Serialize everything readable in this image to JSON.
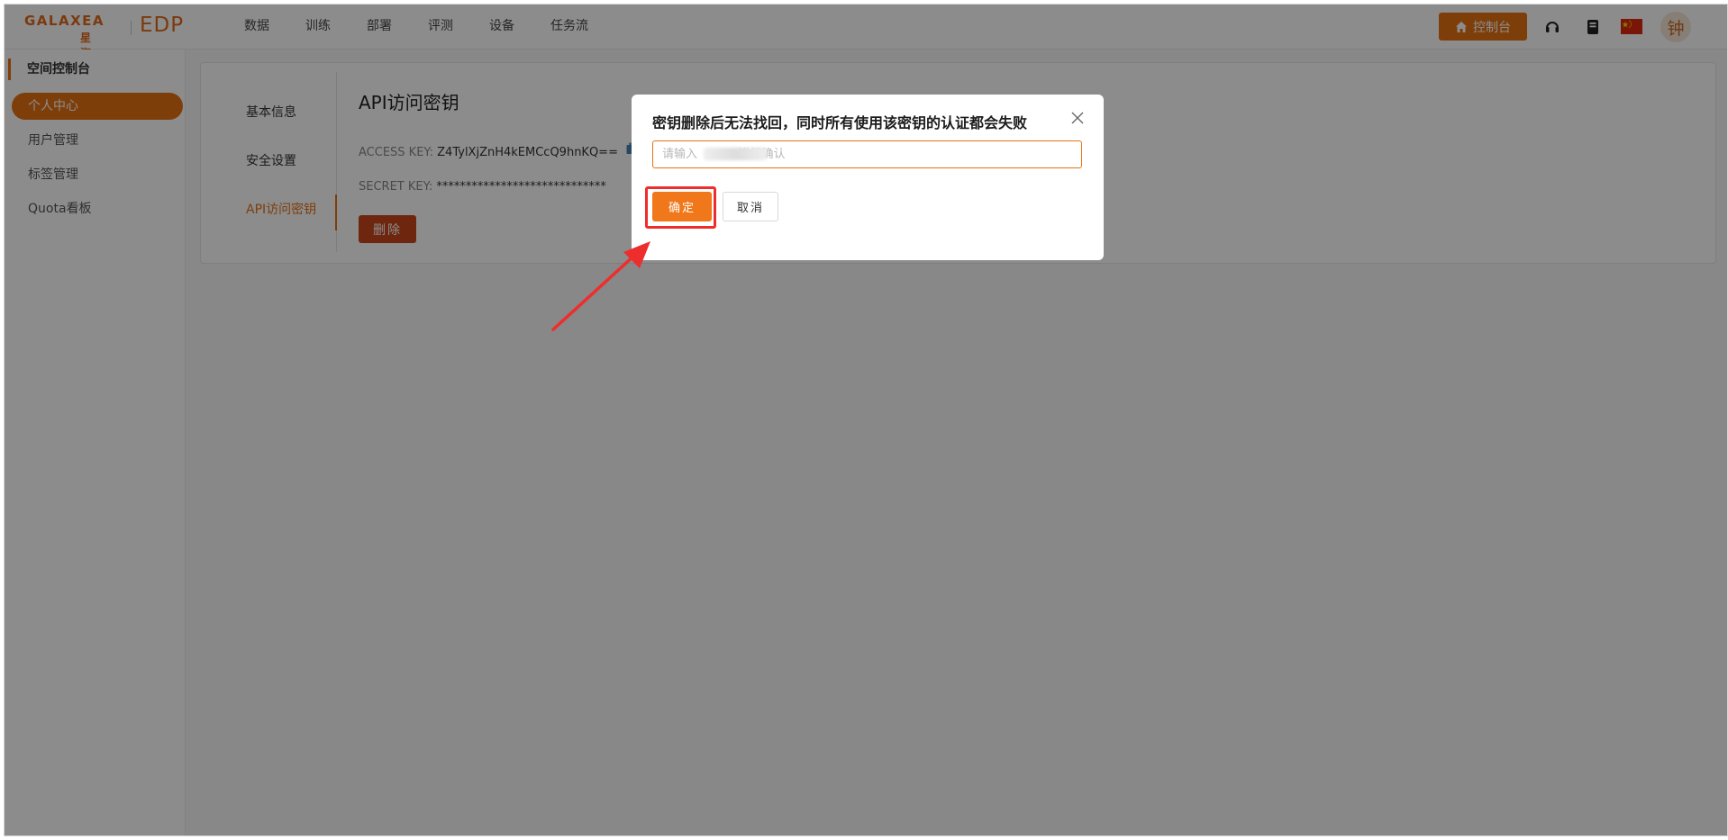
{
  "brand": {
    "logo_text": "GALAXEA",
    "logo_cn": "星海图",
    "product": "EDP"
  },
  "header": {
    "nav": [
      "数据",
      "训练",
      "部署",
      "评测",
      "设备",
      "任务流"
    ],
    "console_label": "控制台",
    "avatar_text": "钟"
  },
  "sidebar": {
    "title": "空间控制台",
    "items": [
      {
        "label": "个人中心",
        "active": true
      },
      {
        "label": "用户管理",
        "active": false
      },
      {
        "label": "标签管理",
        "active": false
      },
      {
        "label": "Quota看板",
        "active": false
      }
    ]
  },
  "subnav": [
    "基本信息",
    "安全设置",
    "API访问密钥"
  ],
  "api": {
    "title": "API访问密钥",
    "access_label": "ACCESS KEY:",
    "access_value": "Z4TylXjZnH4kEMCcQ9hnKQ==",
    "secret_label": "SECRET KEY:",
    "secret_value": "*****************************",
    "delete_label": "删除"
  },
  "modal": {
    "title": "密钥删除后无法找回，同时所有使用该密钥的认证都会失败",
    "input_placeholder": "请输入           进行确认",
    "ok_label": "确定",
    "cancel_label": "取消"
  },
  "colors": {
    "accent": "#e57213",
    "danger": "#c8461d",
    "annotation": "#ee2d2d"
  },
  "icons": {
    "console": "home-icon",
    "headset": "headset-icon",
    "book": "book-icon",
    "flag": "china-flag-icon",
    "copy": "copy-icon",
    "close": "close-icon"
  }
}
